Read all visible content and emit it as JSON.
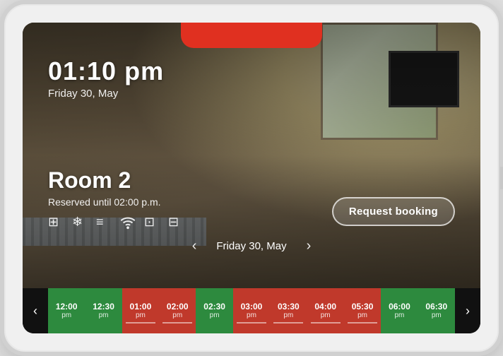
{
  "device": {
    "top_bar_color": "#e03020"
  },
  "header": {
    "time": "01:10 pm",
    "date": "Friday 30, May"
  },
  "room": {
    "name": "Room 2",
    "status": "Reserved until 02:00 p.m.",
    "request_button": "Request booking"
  },
  "amenities": [
    "⊞",
    "❄",
    "≡",
    "wifi",
    "⊡",
    "⊟"
  ],
  "nav": {
    "prev_arrow": "‹",
    "next_arrow": "›",
    "date": "Friday 30, May"
  },
  "timeline": {
    "prev_arrow": "‹",
    "next_arrow": "›",
    "slots": [
      {
        "time": "12:00",
        "period": "pm",
        "type": "green"
      },
      {
        "time": "12:30",
        "period": "pm",
        "type": "green"
      },
      {
        "time": "01:00",
        "period": "pm",
        "type": "red"
      },
      {
        "time": "02:00",
        "period": "pm",
        "type": "red"
      },
      {
        "time": "02:30",
        "period": "pm",
        "type": "green"
      },
      {
        "time": "03:00",
        "period": "pm",
        "type": "red"
      },
      {
        "time": "03:30",
        "period": "pm",
        "type": "red"
      },
      {
        "time": "04:00",
        "period": "pm",
        "type": "red"
      },
      {
        "time": "05:30",
        "period": "pm",
        "type": "red"
      },
      {
        "time": "06:00",
        "period": "pm",
        "type": "green"
      },
      {
        "time": "06:30",
        "period": "pm",
        "type": "green"
      }
    ]
  }
}
